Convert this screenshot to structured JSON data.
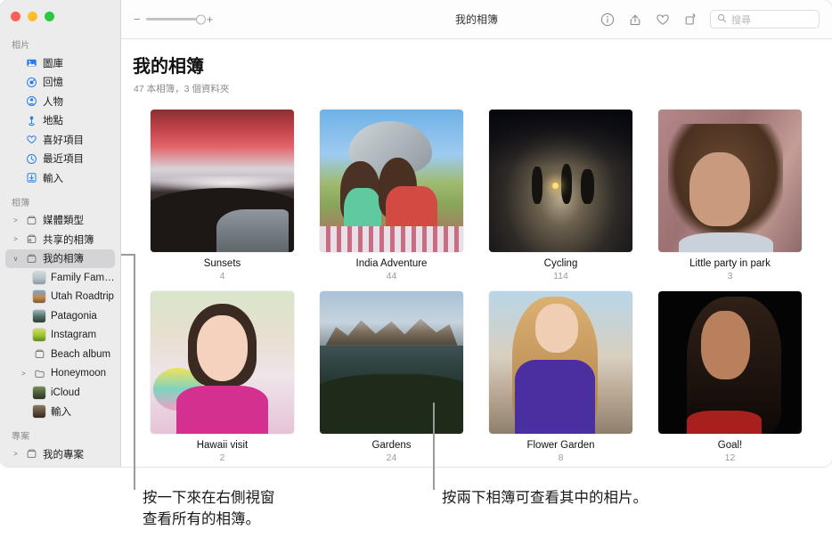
{
  "window": {
    "traffic_lights": [
      "close",
      "minimize",
      "zoom"
    ]
  },
  "toolbar": {
    "zoom_minus": "−",
    "zoom_plus": "+",
    "title": "我的相簿",
    "icons": [
      {
        "name": "info-icon",
        "label": "資訊"
      },
      {
        "name": "share-icon",
        "label": "分享"
      },
      {
        "name": "favorite-heart-icon",
        "label": "喜好項目"
      },
      {
        "name": "rotate-icon",
        "label": "旋轉"
      }
    ],
    "search": {
      "placeholder": "搜尋",
      "value": ""
    }
  },
  "sidebar": {
    "sections": [
      {
        "header": "相片",
        "items": [
          {
            "label": "圖庫",
            "icon": "library-icon",
            "twisty": "none",
            "indent": 0,
            "selected": false
          },
          {
            "label": "回憶",
            "icon": "memories-icon",
            "twisty": "none",
            "indent": 0,
            "selected": false
          },
          {
            "label": "人物",
            "icon": "people-icon",
            "twisty": "none",
            "indent": 0,
            "selected": false
          },
          {
            "label": "地點",
            "icon": "places-pin-icon",
            "twisty": "none",
            "indent": 0,
            "selected": false
          },
          {
            "label": "喜好項目",
            "icon": "heart-icon",
            "twisty": "none",
            "indent": 0,
            "selected": false
          },
          {
            "label": "最近項目",
            "icon": "clock-icon",
            "twisty": "none",
            "indent": 0,
            "selected": false
          },
          {
            "label": "輸入",
            "icon": "import-icon",
            "twisty": "none",
            "indent": 0,
            "selected": false
          }
        ]
      },
      {
        "header": "相簿",
        "items": [
          {
            "label": "媒體類型",
            "icon": "album-box-icon",
            "twisty": "collapsed",
            "indent": 0,
            "selected": false
          },
          {
            "label": "共享的相簿",
            "icon": "shared-album-icon",
            "twisty": "collapsed",
            "indent": 0,
            "selected": false
          },
          {
            "label": "我的相簿",
            "icon": "album-box-icon",
            "twisty": "expanded",
            "indent": 0,
            "selected": true
          },
          {
            "label": "Family Family...",
            "icon": "thumb-family",
            "twisty": "none",
            "indent": 1,
            "selected": false
          },
          {
            "label": "Utah Roadtrip",
            "icon": "thumb-utah",
            "twisty": "none",
            "indent": 1,
            "selected": false
          },
          {
            "label": "Patagonia",
            "icon": "thumb-patagonia",
            "twisty": "none",
            "indent": 1,
            "selected": false
          },
          {
            "label": "Instagram",
            "icon": "thumb-instagram",
            "twisty": "none",
            "indent": 1,
            "selected": false
          },
          {
            "label": "Beach album",
            "icon": "album-box-icon",
            "twisty": "none",
            "indent": 1,
            "selected": false
          },
          {
            "label": "Honeymoon",
            "icon": "folder-icon",
            "twisty": "collapsed",
            "indent": 1,
            "selected": false
          },
          {
            "label": "iCloud",
            "icon": "thumb-icloud",
            "twisty": "none",
            "indent": 1,
            "selected": false
          },
          {
            "label": "輸入",
            "icon": "thumb-import",
            "twisty": "none",
            "indent": 1,
            "selected": false
          }
        ]
      },
      {
        "header": "專案",
        "items": [
          {
            "label": "我的專案",
            "icon": "album-box-icon",
            "twisty": "collapsed",
            "indent": 0,
            "selected": false
          }
        ]
      }
    ]
  },
  "main": {
    "title": "我的相簿",
    "subtitle": "47 本相簿，3 個資料夾",
    "albums": [
      {
        "name": "Sunsets",
        "count": "4",
        "image": "sunset-landscape"
      },
      {
        "name": "India Adventure",
        "count": "44",
        "image": "two-kids-picnic"
      },
      {
        "name": "Cycling",
        "count": "114",
        "image": "night-cyclists"
      },
      {
        "name": "Little party in park",
        "count": "3",
        "image": "curly-hair-portrait"
      },
      {
        "name": "Hawaii visit",
        "count": "2",
        "image": "girl-in-pink"
      },
      {
        "name": "Gardens",
        "count": "24",
        "image": "mountain-lake"
      },
      {
        "name": "Flower Garden",
        "count": "8",
        "image": "woman-purple-shirt"
      },
      {
        "name": "Goal!",
        "count": "12",
        "image": "dark-portrait-red"
      }
    ]
  },
  "callouts": [
    {
      "text": "按一下來在右側視窗\n查看所有的相簿。",
      "target": "sidebar-my-albums"
    },
    {
      "text": "按兩下相簿可查看其中的相片。",
      "target": "album-gardens"
    }
  ],
  "colors": {
    "accent_blue": "#2a7bf0",
    "sidebar_bg": "#ececec",
    "selected_row": "#d4d4d6",
    "leader_line": "#9a9a9a"
  }
}
